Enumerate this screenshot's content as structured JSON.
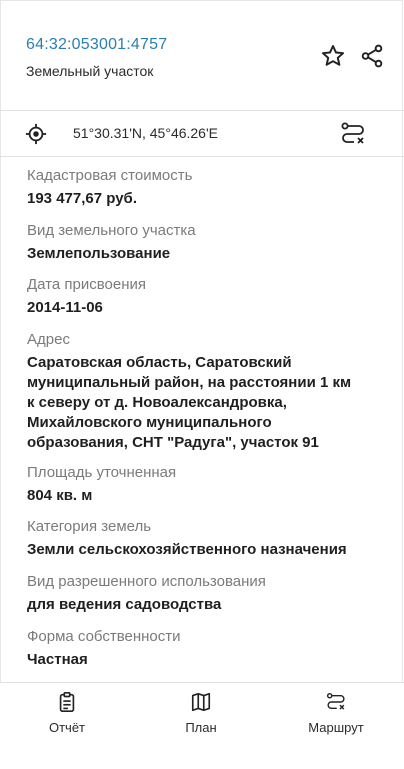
{
  "header": {
    "cadastral_number": "64:32:053001:4757",
    "object_type": "Земельный участок",
    "star_icon": "star-outline-icon",
    "share_icon": "share-icon"
  },
  "location": {
    "coordinates": "51°30.31'N, 45°46.26'E",
    "target_icon": "target-icon",
    "route_icon": "route-icon"
  },
  "attributes": [
    {
      "label": "Кадастровая стоимость",
      "value": "193 477,67 руб."
    },
    {
      "label": "Вид земельного участка",
      "value": "Землепользование"
    },
    {
      "label": "Дата присвоения",
      "value": "2014-11-06"
    },
    {
      "label": "Адрес",
      "value_lines": [
        "Саратовская область, Саратовский",
        "муниципальный район, на расстоянии 1 км",
        "к северу от д. Новоалександровка,",
        "Михайловского муниципального",
        "образования, СНТ \"Радуга\", участок 91"
      ]
    },
    {
      "label": "Площадь уточненная",
      "value": "804 кв. м"
    },
    {
      "label": "Категория земель",
      "value": "Земли сельскохозяйственного назначения"
    },
    {
      "label": "Вид разрешенного использования",
      "value": "для ведения садоводства"
    },
    {
      "label": "Форма собственности",
      "value": "Частная"
    }
  ],
  "bottom_nav": {
    "report_label": "Отчёт",
    "plan_label": "План",
    "route_label": "Маршрут",
    "report_icon": "clipboard-icon",
    "plan_icon": "map-icon",
    "route_icon": "route-icon"
  },
  "colors": {
    "accent": "#2a7fb0",
    "label_gray": "#7b7b7b"
  }
}
